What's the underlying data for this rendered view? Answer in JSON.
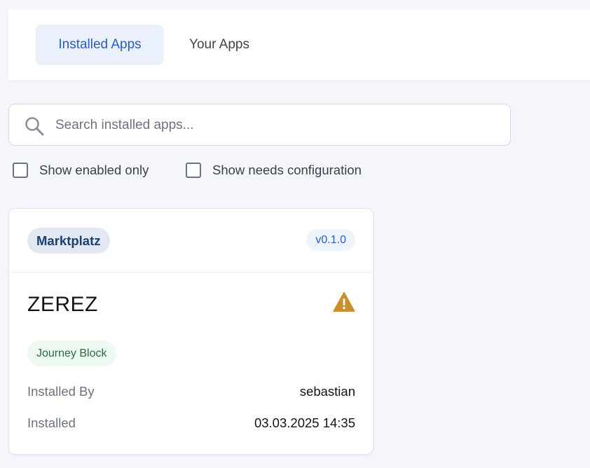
{
  "tabs": {
    "installed_label": "Installed Apps",
    "yours_label": "Your Apps"
  },
  "search": {
    "placeholder": "Search installed apps...",
    "value": ""
  },
  "filters": {
    "enabled_only_label": "Show enabled only",
    "enabled_only_checked": false,
    "needs_config_label": "Show needs configuration",
    "needs_config_checked": false
  },
  "apps": [
    {
      "source": "Marktplatz",
      "version": "v0.1.0",
      "name": "ZEREZ",
      "type": "Journey Block",
      "status_icon": "warning-icon",
      "installed_by_label": "Installed By",
      "installed_by": "sebastian",
      "installed_label": "Installed",
      "installed_at": "03.03.2025 14:35"
    }
  ],
  "colors": {
    "accent": "#2d59c9",
    "active_tab_bg": "#eaf1fb",
    "warning": "#c8912c",
    "type_badge_bg": "#eef9f1",
    "type_badge_text": "#2d6a43"
  }
}
